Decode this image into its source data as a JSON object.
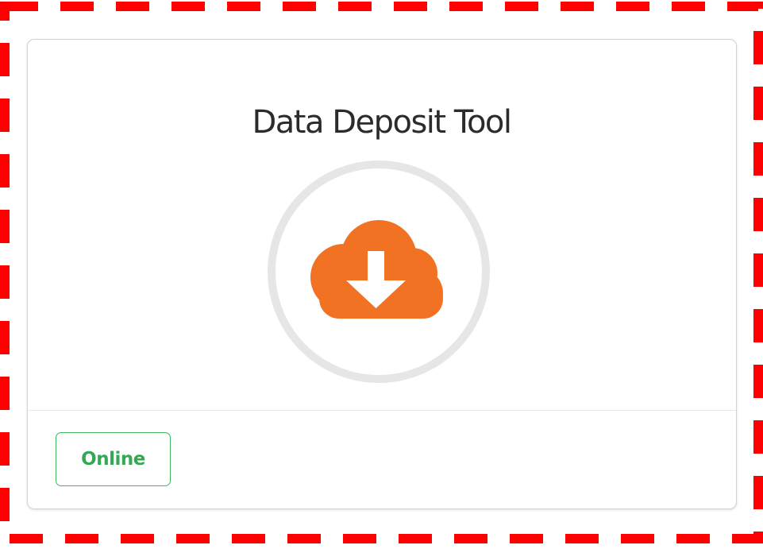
{
  "card": {
    "title": "Data Deposit Tool",
    "icon": "cloud-download-icon",
    "status_label": "Online"
  },
  "colors": {
    "highlight_border": "#ff0000",
    "icon_fill": "#f07222",
    "icon_ring": "#e6e6e6",
    "status_green": "#3cb95a"
  }
}
